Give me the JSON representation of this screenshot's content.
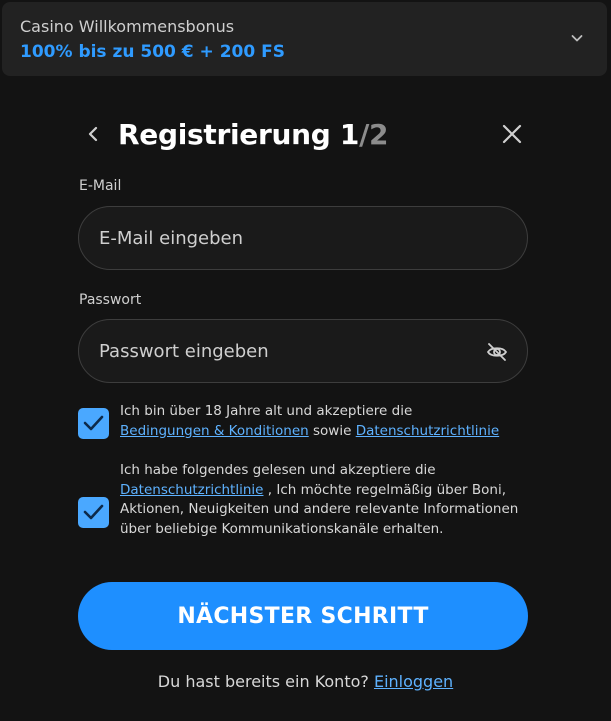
{
  "bonus": {
    "caption": "Casino Willkommensbonus",
    "offer": "100% bis zu 500 € + 200 FS",
    "toggle_icon": "chevron-down-icon"
  },
  "header": {
    "title": "Registrierung",
    "step_current": "1",
    "step_separator": "/",
    "step_total": "2",
    "back_icon": "chevron-left-icon",
    "close_icon": "close-icon"
  },
  "email": {
    "label": "E-Mail",
    "placeholder": "E-Mail eingeben",
    "value": ""
  },
  "password": {
    "label": "Passwort",
    "placeholder": "Passwort eingeben",
    "value": "",
    "toggle_icon": "eye-off-icon"
  },
  "consent_terms": {
    "checked": true,
    "text_before": "Ich bin über 18 Jahre alt und akzeptiere die",
    "link_terms": "Bedingungen & Konditionen",
    "text_middle": "sowie",
    "link_privacy": "Datenschutzrichtlinie"
  },
  "consent_marketing": {
    "checked": true,
    "text_before": "Ich habe folgendes gelesen und akzeptiere die",
    "link_privacy": "Datenschutzrichtlinie",
    "text_after": ", Ich möchte regelmäßig über Boni, Aktionen, Neuigkeiten und andere relevante Informationen über beliebige Kommunikationskanäle erhalten."
  },
  "next_button": "NÄCHSTER SCHRITT",
  "login": {
    "prompt": "Du hast bereits ein Konto?",
    "link": "Einloggen"
  },
  "colors": {
    "background": "#131313",
    "accent": "#1e8fff",
    "link": "#5eb2ff",
    "checkbox": "#4aa8ff"
  }
}
